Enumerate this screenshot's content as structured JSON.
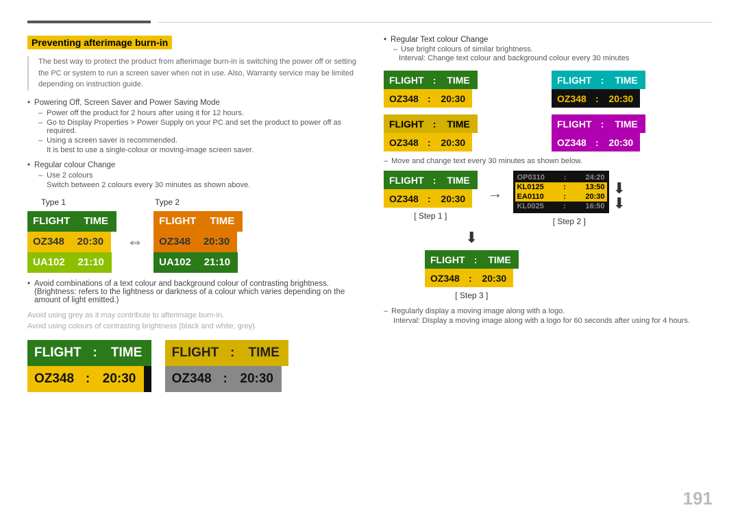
{
  "page": {
    "number": "191"
  },
  "header": {
    "title": "Preventing afterimage burn-in"
  },
  "intro": {
    "text": "The best way to protect the product from afterimage burn-in is switching the power off or setting the PC or system to run a screen saver when not in use. Also, Warranty service may be limited depending on instruction guide."
  },
  "bullets": {
    "powering": {
      "main": "Powering Off, Screen Saver and Power Saving Mode",
      "subs": [
        "Power off the product for 2 hours after using it for 12 hours.",
        "Go to Display Properties > Power Supply on your PC and set the product to power off as required.",
        "Using a screen saver is recommended.",
        "It is best to use a single-colour or moving-image screen saver."
      ]
    },
    "regular_colour": {
      "main": "Regular colour Change",
      "subs": [
        "Use 2 colours",
        "Switch between 2 colours every 30 minutes as shown above."
      ]
    }
  },
  "type_labels": {
    "type1": "Type 1",
    "type2": "Type 2"
  },
  "type1_board": {
    "row1": [
      "FLIGHT",
      "TIME"
    ],
    "row2": [
      "OZ348",
      "20:30"
    ],
    "row3": [
      "UA102",
      "21:10"
    ]
  },
  "type2_board": {
    "row1": [
      "FLIGHT",
      "TIME"
    ],
    "row2": [
      "OZ348",
      "20:30"
    ],
    "row3": [
      "UA102",
      "21:10"
    ]
  },
  "avoid_texts": {
    "gray": "Avoid using grey as it may contribute to afterimage burn-in.",
    "contrast": "Avoid using colours of contrasting brightness (black and white; grey)."
  },
  "bottom_left_board": {
    "header": [
      "FLIGHT",
      ":",
      "TIME"
    ],
    "data": [
      "OZ348",
      ":",
      "20:30"
    ]
  },
  "bottom_right_board": {
    "header": [
      "FLIGHT",
      ":",
      "TIME"
    ],
    "data": [
      "OZ348",
      ":",
      "20:30"
    ]
  },
  "right_col": {
    "bullet_text": "Regular Text colour Change",
    "sub1": "Use bright colours of similar brightness.",
    "sub2": "Interval: Change text colour and background colour every 30 minutes",
    "boards": [
      {
        "hdr_color": "green",
        "data_color": "yellow",
        "label": ""
      },
      {
        "hdr_color": "cyan",
        "data_color": "black",
        "label": ""
      },
      {
        "hdr_color": "yellow",
        "data_color": "yellow",
        "label": ""
      },
      {
        "hdr_color": "magenta",
        "data_color": "magenta",
        "label": ""
      }
    ],
    "flight_label": "FLIGHT",
    "time_label": "TIME",
    "oz348": "OZ348",
    "colon": ":",
    "time_val": "20:30",
    "move_dash": "Move and change text every 30 minutes as shown below.",
    "step1_label": "[ Step 1 ]",
    "step2_label": "[ Step 2 ]",
    "step3_label": "[ Step 3 ]",
    "scroll_rows": [
      {
        "text": "OP0310 : 24:20",
        "state": "dim"
      },
      {
        "text": "KL0125 : 13:50",
        "state": "active"
      },
      {
        "text": "EA0110 : 20:30",
        "state": "active"
      },
      {
        "text": "KL0025 : 16:50",
        "state": "dim"
      }
    ],
    "reg_bullet": "Regularly display a moving image along with a logo.",
    "reg_sub": "Interval: Display a moving image along with a logo for 60 seconds after using for 4 hours."
  }
}
